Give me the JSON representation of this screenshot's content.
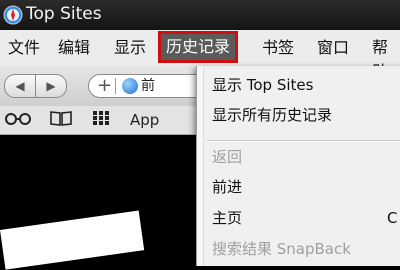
{
  "window": {
    "title": "Top Sites"
  },
  "menubar": {
    "items": [
      {
        "label": "文件"
      },
      {
        "label": "编辑"
      },
      {
        "label": "显示"
      },
      {
        "label": "历史记录"
      },
      {
        "label": "书签"
      },
      {
        "label": "窗口"
      },
      {
        "label": "帮助"
      }
    ],
    "active_index": 3
  },
  "toolbar": {
    "back_icon": "back-arrow-icon",
    "forward_icon": "forward-arrow-icon",
    "add_icon": "plus-icon",
    "address_text": "前"
  },
  "bookmarks": {
    "reading_list_icon": "glasses-icon",
    "bookmarks_icon": "book-icon",
    "top_sites_icon": "grid-icon",
    "first_label": "App"
  },
  "history_menu": {
    "items": [
      {
        "label": "显示 Top Sites",
        "enabled": true
      },
      {
        "label": "显示所有历史记录",
        "enabled": true
      },
      {
        "label": "返回",
        "enabled": false
      },
      {
        "label": "前进",
        "enabled": true
      },
      {
        "label": "主页",
        "enabled": true,
        "shortcut": "C"
      },
      {
        "label": "搜索结果 SnapBack",
        "enabled": false
      }
    ]
  },
  "colors": {
    "highlight_outline": "#d01010",
    "active_menu_bg": "#5b5b5b"
  }
}
